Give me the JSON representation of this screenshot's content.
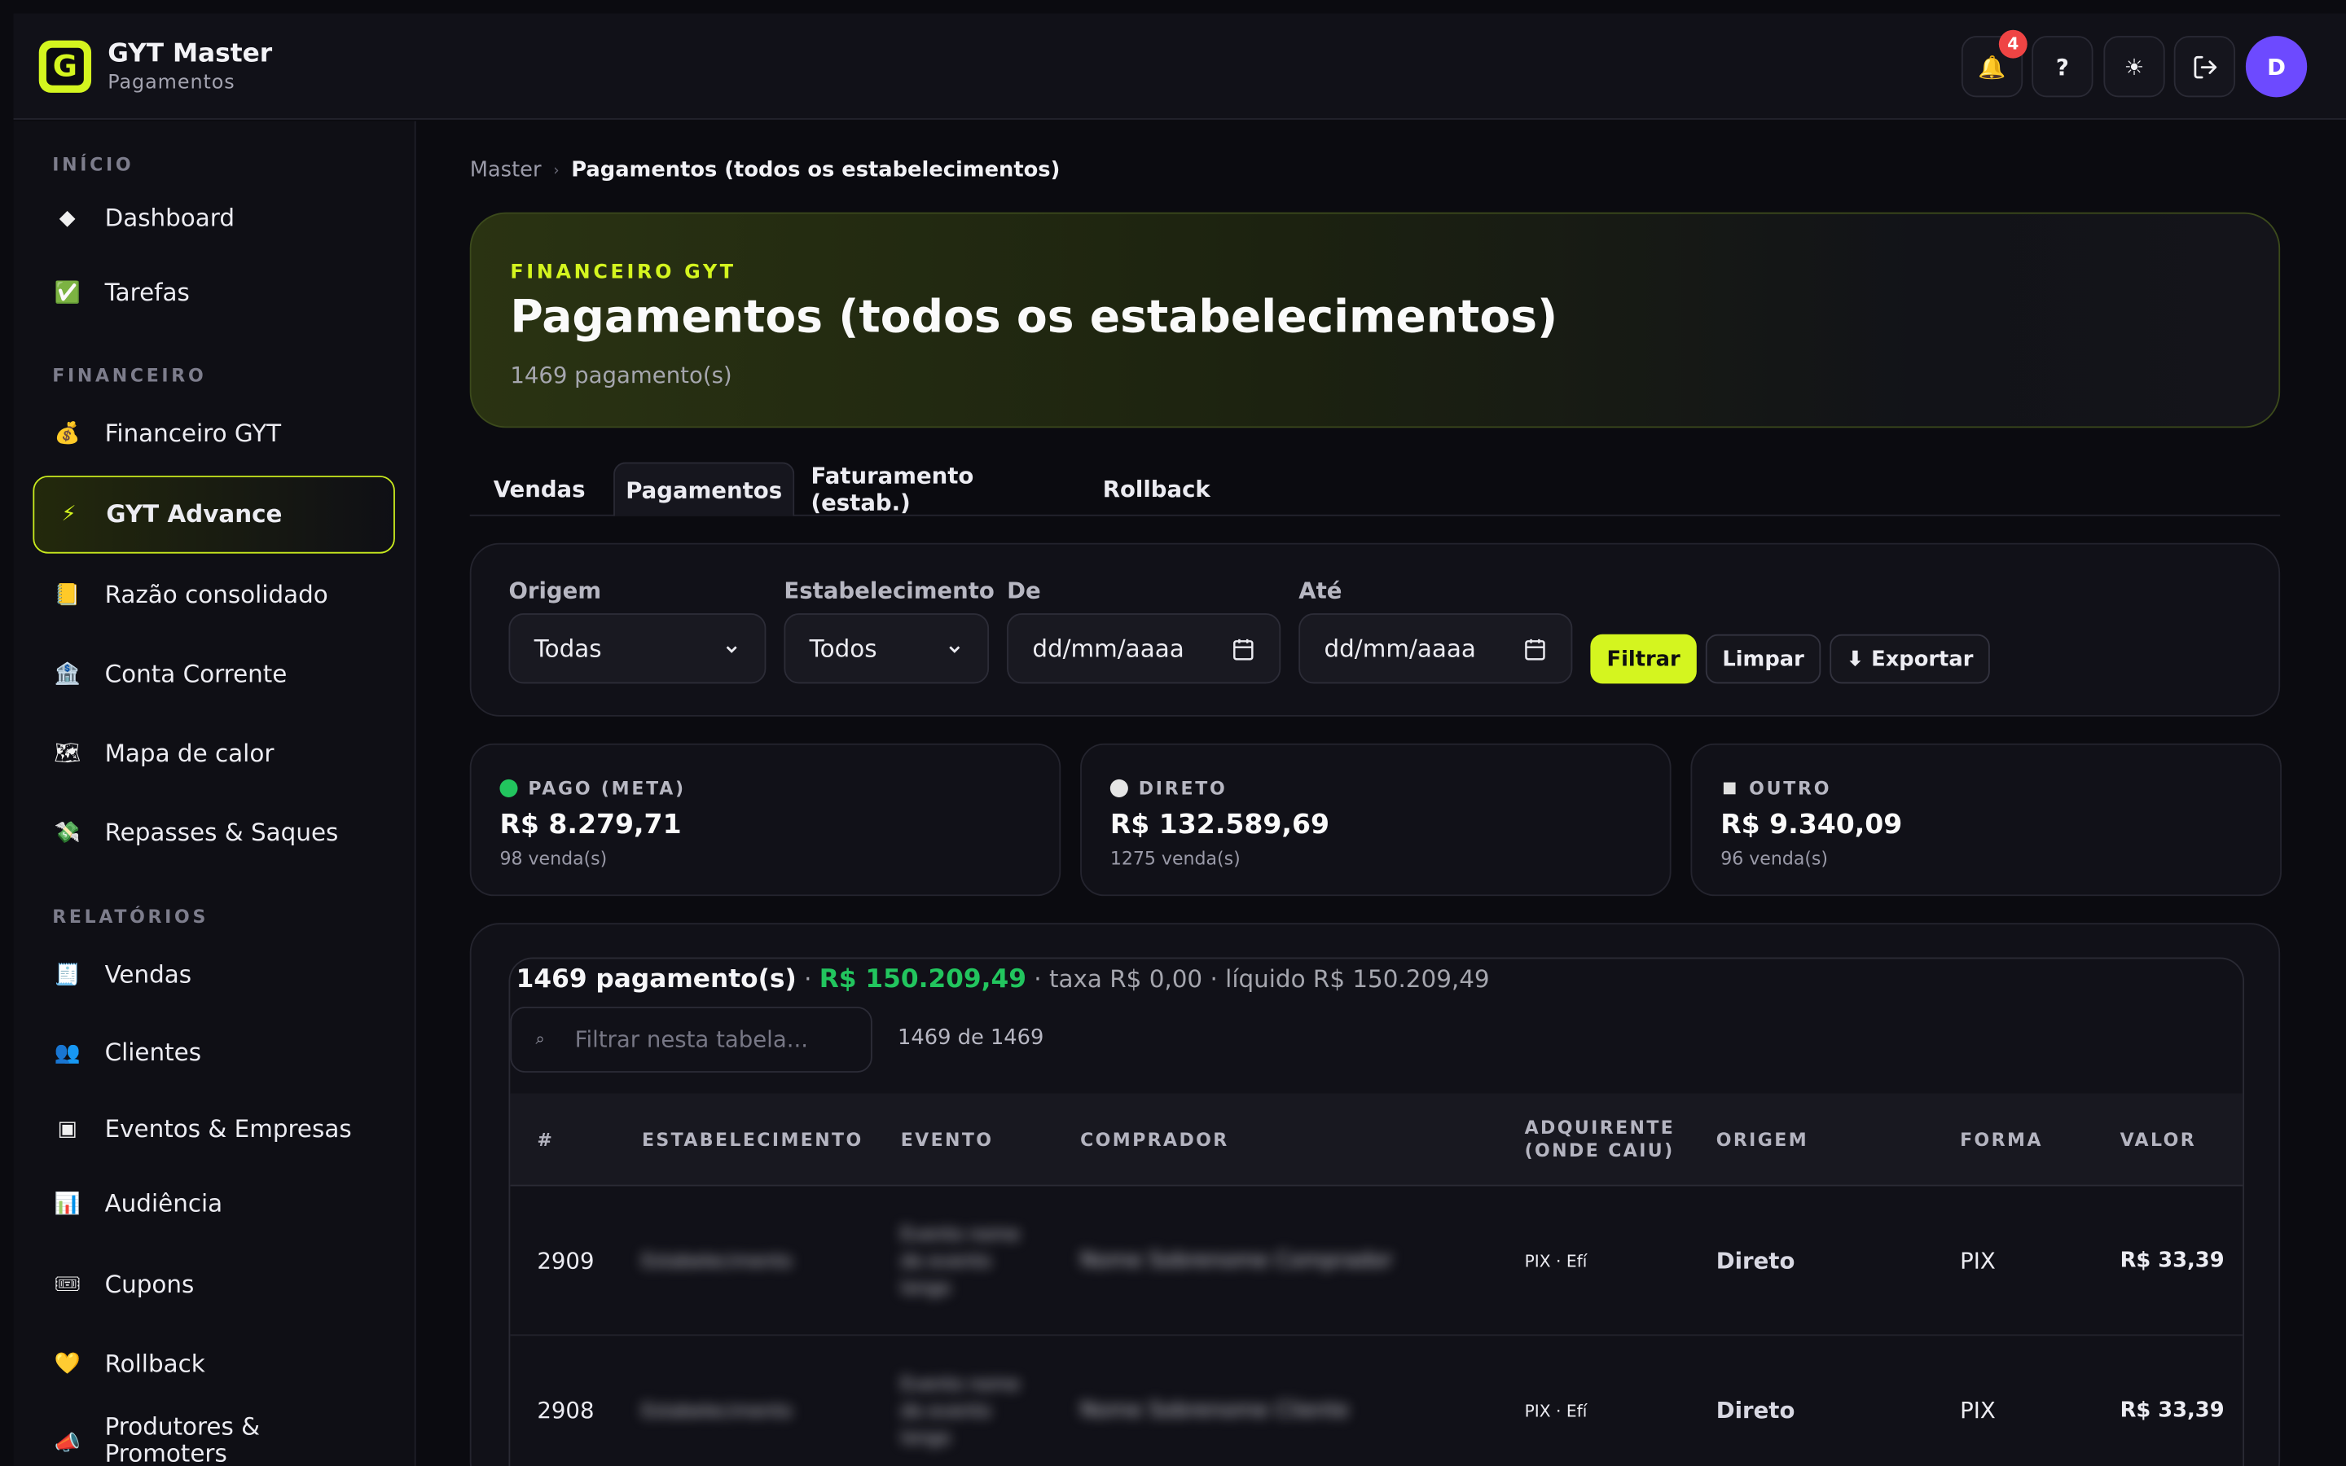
{
  "app": {
    "title": "GYT Master",
    "subtitle": "Pagamentos",
    "logo_letter": "G",
    "accent": "#d4f51f"
  },
  "topbar": {
    "notifications_icon": "🔔",
    "notifications_count": "4",
    "help_icon": "?",
    "theme_icon": "☀",
    "logout_icon": "⇥",
    "avatar_letter": "D"
  },
  "sidebar": {
    "sections": [
      {
        "title": "INÍCIO"
      },
      {
        "title": "FINANCEIRO"
      },
      {
        "title": "RELATÓRIOS"
      }
    ],
    "items": [
      {
        "icon": "◆",
        "label": "Dashboard"
      },
      {
        "icon": "✅",
        "label": "Tarefas"
      },
      {
        "icon": "💰",
        "label": "Financeiro GYT"
      },
      {
        "icon": "⚡",
        "label": "GYT Advance"
      },
      {
        "icon": "📒",
        "label": "Razão consolidado"
      },
      {
        "icon": "🏦",
        "label": "Conta Corrente"
      },
      {
        "icon": "🗺",
        "label": "Mapa de calor"
      },
      {
        "icon": "💸",
        "label": "Repasses & Saques"
      },
      {
        "icon": "🧾",
        "label": "Vendas"
      },
      {
        "icon": "👥",
        "label": "Clientes"
      },
      {
        "icon": "▣",
        "label": "Eventos & Empresas"
      },
      {
        "icon": "📊",
        "label": "Audiência"
      },
      {
        "icon": "🎟",
        "label": "Cupons"
      },
      {
        "icon": "💛",
        "label": "Rollback"
      },
      {
        "icon": "📣",
        "label": "Produtores & Promoters"
      }
    ]
  },
  "breadcrumb": {
    "parent": "Master",
    "sep": "›",
    "current": "Pagamentos (todos os estabelecimentos)"
  },
  "hero": {
    "kicker": "FINANCEIRO GYT",
    "title": "Pagamentos (todos os estabelecimentos)",
    "count": "1469 pagamento(s)"
  },
  "tabs": [
    {
      "label": "Vendas"
    },
    {
      "label": "Pagamentos"
    },
    {
      "label": "Faturamento (estab.)"
    },
    {
      "label": "Rollback"
    }
  ],
  "filters": {
    "origem": {
      "label": "Origem",
      "value": "Todas"
    },
    "estab": {
      "label": "Estabelecimento",
      "value": "Todos"
    },
    "de": {
      "label": "De",
      "value": "dd/mm/aaaa"
    },
    "ate": {
      "label": "Até",
      "value": "dd/mm/aaaa"
    },
    "filtrar": "Filtrar",
    "limpar": "Limpar",
    "exportar": "⬇ Exportar"
  },
  "cards": [
    {
      "title": "PAGO (META)",
      "value": "R$ 8.279,71",
      "sub": "98 venda(s)",
      "color": "#22c55e"
    },
    {
      "title": "DIRETO",
      "value": "R$ 132.589,69",
      "sub": "1275 venda(s)",
      "color": "#e5e5e5"
    },
    {
      "title": "OUTRO",
      "value": "R$ 9.340,09",
      "sub": "96 venda(s)",
      "color": "#e5e5e5"
    }
  ],
  "table": {
    "summary_count": "1469 pagamento(s)",
    "summary_sep1": " · ",
    "summary_total": "R$ 150.209,49",
    "summary_rest": " · taxa R$ 0,00 · líquido R$ 150.209,49",
    "search_placeholder": "Filtrar nesta tabela...",
    "search_icon": "⌕",
    "count": "1469 de 1469",
    "headers": [
      "#",
      "ESTABELECIMENTO",
      "EVENTO",
      "COMPRADOR",
      "ADQUIRENTE (ONDE CAIU)",
      "ORIGEM",
      "FORMA",
      "VALOR"
    ],
    "rows": [
      {
        "id": "2909",
        "estab": "Estabelecimento",
        "evento": "Evento nome do evento longo",
        "comprador": "Nome Sobrenome Comprador",
        "adquirente": "PIX · Efí",
        "origem": "Direto",
        "forma": "PIX",
        "valor": "R$ 33,39"
      },
      {
        "id": "2908",
        "estab": "Estabelecimento",
        "evento": "Evento nome do evento longo",
        "comprador": "Nome Sobrenome Cliente",
        "adquirente": "PIX · Efí",
        "origem": "Direto",
        "forma": "PIX",
        "valor": "R$ 33,39"
      }
    ]
  }
}
